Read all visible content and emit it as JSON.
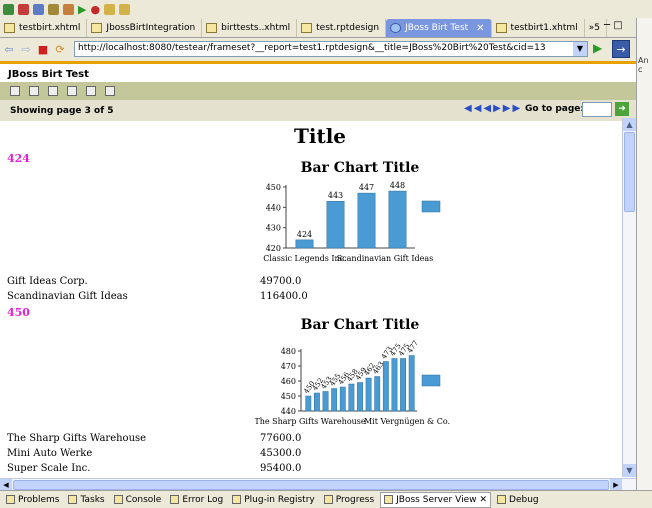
{
  "editor_tabs": [
    {
      "label": "testbirt.xhtml"
    },
    {
      "label": "JbossBirtIntegration"
    },
    {
      "label": "birttests..xhtml"
    },
    {
      "label": "test.rptdesign"
    },
    {
      "label": "JBoss Birt Test",
      "active": true
    },
    {
      "label": "testbirt1.xhtml"
    }
  ],
  "more_tabs": "»5",
  "url": "http://localhost:8080/testear/frameset?__report=test1.rptdesign&__title=JBoss%20Birt%20Test&cid=13",
  "right_panel_label": "An c",
  "viewer": {
    "title": "JBoss Birt Test",
    "showing_page": "Showing page  3  of  5",
    "goto_label": "Go to page:"
  },
  "report": {
    "title": "Title",
    "groups": [
      {
        "label": "424",
        "chart_title": "Bar Chart Title"
      },
      {
        "label": "450",
        "chart_title": "Bar Chart Title"
      }
    ],
    "rows1": [
      {
        "name": "Gift Ideas Corp.",
        "value": "49700.0"
      },
      {
        "name": "Scandinavian Gift Ideas",
        "value": "116400.0"
      }
    ],
    "rows2": [
      {
        "name": "The Sharp Gifts Warehouse",
        "value": "77600.0"
      },
      {
        "name": "Mini Auto Werke",
        "value": "45300.0"
      },
      {
        "name": "Super Scale Inc.",
        "value": "95400.0"
      }
    ]
  },
  "chart_data": [
    {
      "type": "bar",
      "title": "Bar Chart Title",
      "categories": [
        "Classic Legends Inc.",
        "",
        "Scandinavian Gift Ideas",
        ""
      ],
      "values": [
        424,
        443,
        447,
        448
      ],
      "ylim": [
        420,
        450
      ],
      "yticks": [
        420,
        430,
        440,
        450
      ],
      "xtick_labels": [
        "Classic Legends Inc.",
        "Scandinavian Gift Ideas"
      ]
    },
    {
      "type": "bar",
      "title": "Bar Chart Title",
      "values": [
        450,
        452,
        453,
        455,
        456,
        458,
        459,
        462,
        463,
        473,
        475,
        475,
        477
      ],
      "bar_labels": [
        "450",
        "452",
        "453",
        "455",
        "456",
        "458",
        "459",
        "462",
        "463",
        "473",
        "475",
        "475",
        "477"
      ],
      "ylim": [
        440,
        480
      ],
      "yticks": [
        440,
        450,
        460,
        470,
        480
      ],
      "xtick_labels": [
        "The Sharp Gifts Warehouse",
        "Mit Vergnügen & Co."
      ]
    }
  ],
  "bottom_tabs": [
    {
      "label": "Problems"
    },
    {
      "label": "Tasks"
    },
    {
      "label": "Console"
    },
    {
      "label": "Error Log"
    },
    {
      "label": "Plug-in Registry"
    },
    {
      "label": "Progress"
    },
    {
      "label": "JBoss Server View",
      "active": true
    },
    {
      "label": "Debug"
    }
  ],
  "colors": {
    "bar": "#4a9bd4",
    "group": "#e41fd5",
    "accent": "#e7a100"
  }
}
